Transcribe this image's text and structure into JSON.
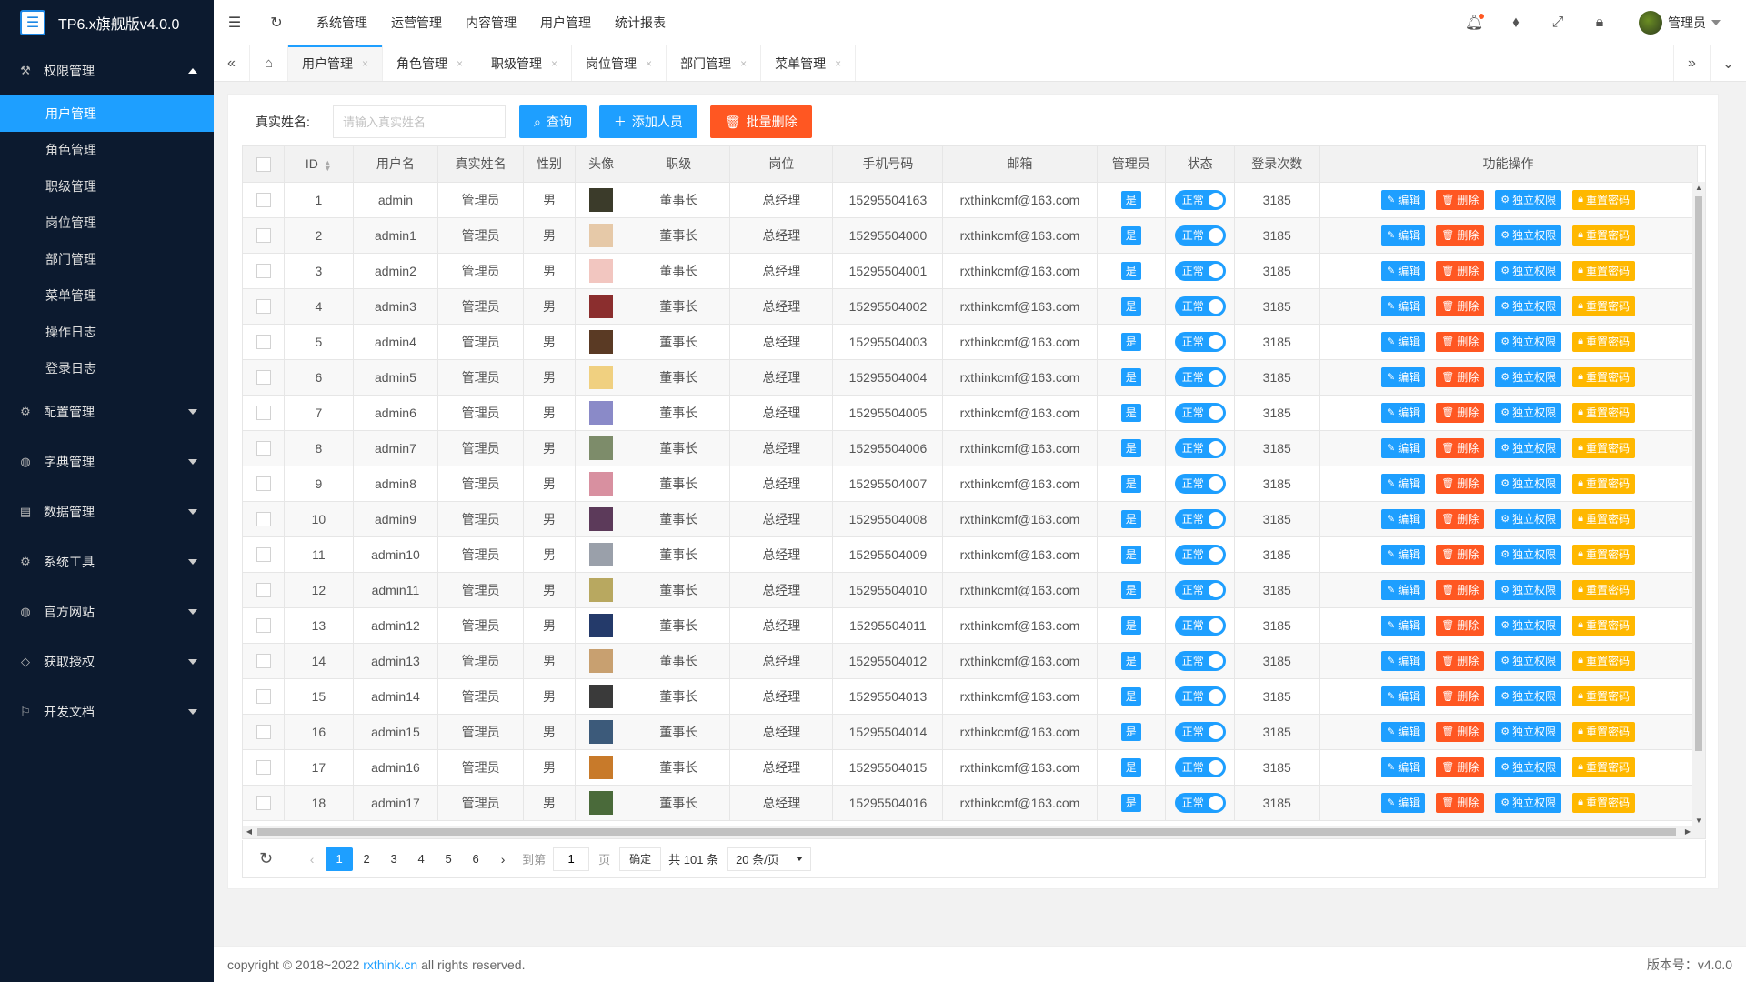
{
  "app": {
    "title": "TP6.x旗舰版v4.0.0"
  },
  "sidebar": {
    "groups": [
      {
        "label": "权限管理",
        "icon": "permission-icon",
        "expanded": true,
        "items": [
          "用户管理",
          "角色管理",
          "职级管理",
          "岗位管理",
          "部门管理",
          "菜单管理",
          "操作日志",
          "登录日志"
        ]
      },
      {
        "label": "配置管理",
        "icon": "gear-icon"
      },
      {
        "label": "字典管理",
        "icon": "globe-icon"
      },
      {
        "label": "数据管理",
        "icon": "book-icon"
      },
      {
        "label": "系统工具",
        "icon": "gear-icon"
      },
      {
        "label": "官方网站",
        "icon": "globe-icon"
      },
      {
        "label": "获取授权",
        "icon": "diamond-icon"
      },
      {
        "label": "开发文档",
        "icon": "flag-icon"
      }
    ],
    "active_item": "用户管理"
  },
  "header": {
    "menu": [
      "系统管理",
      "运营管理",
      "内容管理",
      "用户管理",
      "统计报表"
    ],
    "active_menu": "系统管理",
    "user_name": "管理员"
  },
  "tabs": {
    "items": [
      "用户管理",
      "角色管理",
      "职级管理",
      "岗位管理",
      "部门管理",
      "菜单管理"
    ],
    "active": "用户管理"
  },
  "search": {
    "label": "真实姓名:",
    "placeholder": "请输入真实姓名",
    "query_label": "查询",
    "add_label": "添加人员",
    "batch_delete_label": "批量删除"
  },
  "table": {
    "columns": [
      "ID",
      "用户名",
      "真实姓名",
      "性别",
      "头像",
      "职级",
      "岗位",
      "手机号码",
      "邮箱",
      "管理员",
      "状态",
      "登录次数",
      "功能操作"
    ],
    "actions": {
      "edit": "编辑",
      "delete": "删除",
      "perm": "独立权限",
      "reset": "重置密码"
    },
    "admin_tag": "是",
    "status_text": "正常",
    "rows": [
      {
        "id": "1",
        "username": "admin",
        "realname": "管理员",
        "gender": "男",
        "level": "董事长",
        "position": "总经理",
        "mobile": "15295504163",
        "email": "rxthinkcmf@163.com",
        "logins": "3185",
        "avatar_color": "#3b3b2a"
      },
      {
        "id": "2",
        "username": "admin1",
        "realname": "管理员",
        "gender": "男",
        "level": "董事长",
        "position": "总经理",
        "mobile": "15295504000",
        "email": "rxthinkcmf@163.com",
        "logins": "3185",
        "avatar_color": "#e6c9a8"
      },
      {
        "id": "3",
        "username": "admin2",
        "realname": "管理员",
        "gender": "男",
        "level": "董事长",
        "position": "总经理",
        "mobile": "15295504001",
        "email": "rxthinkcmf@163.com",
        "logins": "3185",
        "avatar_color": "#f2c6c0"
      },
      {
        "id": "4",
        "username": "admin3",
        "realname": "管理员",
        "gender": "男",
        "level": "董事长",
        "position": "总经理",
        "mobile": "15295504002",
        "email": "rxthinkcmf@163.com",
        "logins": "3185",
        "avatar_color": "#8b2e2e"
      },
      {
        "id": "5",
        "username": "admin4",
        "realname": "管理员",
        "gender": "男",
        "level": "董事长",
        "position": "总经理",
        "mobile": "15295504003",
        "email": "rxthinkcmf@163.com",
        "logins": "3185",
        "avatar_color": "#5a3a24"
      },
      {
        "id": "6",
        "username": "admin5",
        "realname": "管理员",
        "gender": "男",
        "level": "董事长",
        "position": "总经理",
        "mobile": "15295504004",
        "email": "rxthinkcmf@163.com",
        "logins": "3185",
        "avatar_color": "#f0d080"
      },
      {
        "id": "7",
        "username": "admin6",
        "realname": "管理员",
        "gender": "男",
        "level": "董事长",
        "position": "总经理",
        "mobile": "15295504005",
        "email": "rxthinkcmf@163.com",
        "logins": "3185",
        "avatar_color": "#8a8ac8"
      },
      {
        "id": "8",
        "username": "admin7",
        "realname": "管理员",
        "gender": "男",
        "level": "董事长",
        "position": "总经理",
        "mobile": "15295504006",
        "email": "rxthinkcmf@163.com",
        "logins": "3185",
        "avatar_color": "#7d8c6a"
      },
      {
        "id": "9",
        "username": "admin8",
        "realname": "管理员",
        "gender": "男",
        "level": "董事长",
        "position": "总经理",
        "mobile": "15295504007",
        "email": "rxthinkcmf@163.com",
        "logins": "3185",
        "avatar_color": "#d890a0"
      },
      {
        "id": "10",
        "username": "admin9",
        "realname": "管理员",
        "gender": "男",
        "level": "董事长",
        "position": "总经理",
        "mobile": "15295504008",
        "email": "rxthinkcmf@163.com",
        "logins": "3185",
        "avatar_color": "#5c3a5a"
      },
      {
        "id": "11",
        "username": "admin10",
        "realname": "管理员",
        "gender": "男",
        "level": "董事长",
        "position": "总经理",
        "mobile": "15295504009",
        "email": "rxthinkcmf@163.com",
        "logins": "3185",
        "avatar_color": "#9aa0aa"
      },
      {
        "id": "12",
        "username": "admin11",
        "realname": "管理员",
        "gender": "男",
        "level": "董事长",
        "position": "总经理",
        "mobile": "15295504010",
        "email": "rxthinkcmf@163.com",
        "logins": "3185",
        "avatar_color": "#b8a860"
      },
      {
        "id": "13",
        "username": "admin12",
        "realname": "管理员",
        "gender": "男",
        "level": "董事长",
        "position": "总经理",
        "mobile": "15295504011",
        "email": "rxthinkcmf@163.com",
        "logins": "3185",
        "avatar_color": "#243a6a"
      },
      {
        "id": "14",
        "username": "admin13",
        "realname": "管理员",
        "gender": "男",
        "level": "董事长",
        "position": "总经理",
        "mobile": "15295504012",
        "email": "rxthinkcmf@163.com",
        "logins": "3185",
        "avatar_color": "#c8a070"
      },
      {
        "id": "15",
        "username": "admin14",
        "realname": "管理员",
        "gender": "男",
        "level": "董事长",
        "position": "总经理",
        "mobile": "15295504013",
        "email": "rxthinkcmf@163.com",
        "logins": "3185",
        "avatar_color": "#3a3a3a"
      },
      {
        "id": "16",
        "username": "admin15",
        "realname": "管理员",
        "gender": "男",
        "level": "董事长",
        "position": "总经理",
        "mobile": "15295504014",
        "email": "rxthinkcmf@163.com",
        "logins": "3185",
        "avatar_color": "#3c5a7a"
      },
      {
        "id": "17",
        "username": "admin16",
        "realname": "管理员",
        "gender": "男",
        "level": "董事长",
        "position": "总经理",
        "mobile": "15295504015",
        "email": "rxthinkcmf@163.com",
        "logins": "3185",
        "avatar_color": "#c87a2a"
      },
      {
        "id": "18",
        "username": "admin17",
        "realname": "管理员",
        "gender": "男",
        "level": "董事长",
        "position": "总经理",
        "mobile": "15295504016",
        "email": "rxthinkcmf@163.com",
        "logins": "3185",
        "avatar_color": "#4a6a3a"
      }
    ]
  },
  "pagination": {
    "pages": [
      "1",
      "2",
      "3",
      "4",
      "5",
      "6"
    ],
    "current": "1",
    "goto_label": "到第",
    "goto_value": "1",
    "goto_unit": "页",
    "confirm_label": "确定",
    "total_text": "共 101 条",
    "per_page": "20 条/页"
  },
  "footer": {
    "copyright_prefix": "copyright © 2018~2022 ",
    "link_text": "rxthink.cn",
    "copyright_suffix": " all rights reserved.",
    "version": "版本号：v4.0.0"
  },
  "colors": {
    "primary": "#1e9fff",
    "danger": "#ff5722",
    "warning": "#ffb800",
    "sidebar_bg": "#0c1a2f"
  }
}
